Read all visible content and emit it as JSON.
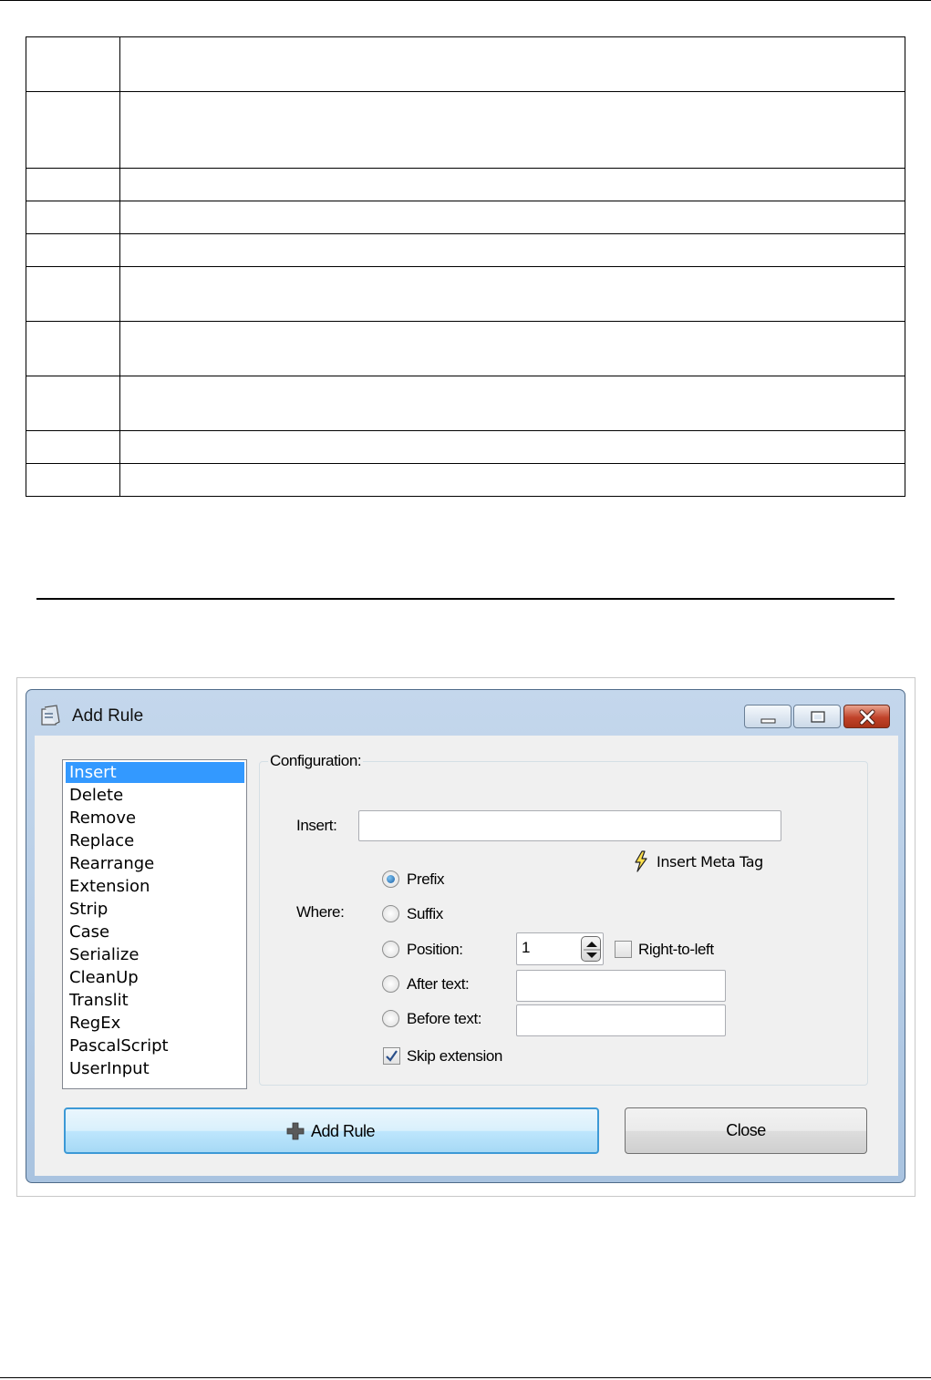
{
  "dialog": {
    "title": "Add Rule",
    "rules_list": {
      "items": [
        "Insert",
        "Delete",
        "Remove",
        "Replace",
        "Rearrange",
        "Extension",
        "Strip",
        "Case",
        "Serialize",
        "CleanUp",
        "Translit",
        "RegEx",
        "PascalScript",
        "UserInput"
      ],
      "selected": "Insert"
    },
    "configuration": {
      "group_label": "Configuration:",
      "insert_label": "Insert:",
      "insert_value": "",
      "meta_tag_label": "Insert Meta Tag",
      "where_label": "Where:",
      "options": {
        "prefix": "Prefix",
        "suffix": "Suffix",
        "position": "Position:",
        "after_text": "After text:",
        "before_text": "Before text:"
      },
      "selected_option": "Prefix",
      "position_value": "1",
      "right_to_left_label": "Right-to-left",
      "right_to_left_checked": false,
      "after_text_value": "",
      "before_text_value": "",
      "skip_extension_label": "Skip extension",
      "skip_extension_checked": true
    },
    "buttons": {
      "add_rule": "Add Rule",
      "close": "Close"
    }
  },
  "colors": {
    "selection": "#3399ff",
    "title_bar": "#b9cfe7",
    "close_button": "#c1432a"
  }
}
